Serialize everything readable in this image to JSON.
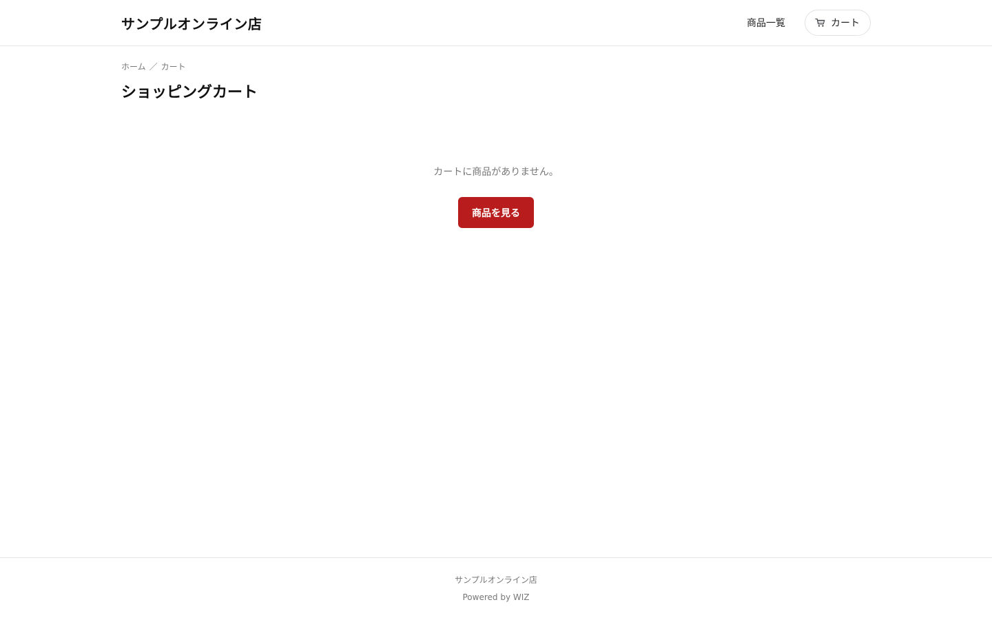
{
  "header": {
    "shop_name": "サンプルオンライン店",
    "nav_products": "商品一覧",
    "cart_label": "カート",
    "cart_icon": "cart-icon"
  },
  "breadcrumb": {
    "home": "ホーム",
    "separator": "／",
    "current": "カート"
  },
  "main": {
    "title": "ショッピングカート",
    "empty_message": "カートに商品がありません。",
    "browse_button": "商品を見る"
  },
  "footer": {
    "shop_name": "サンプルオンライン店",
    "powered_by": "Powered by WIZ"
  },
  "colors": {
    "accent": "#b91c1c",
    "muted_text": "#777777",
    "border": "#e6e6e6"
  }
}
